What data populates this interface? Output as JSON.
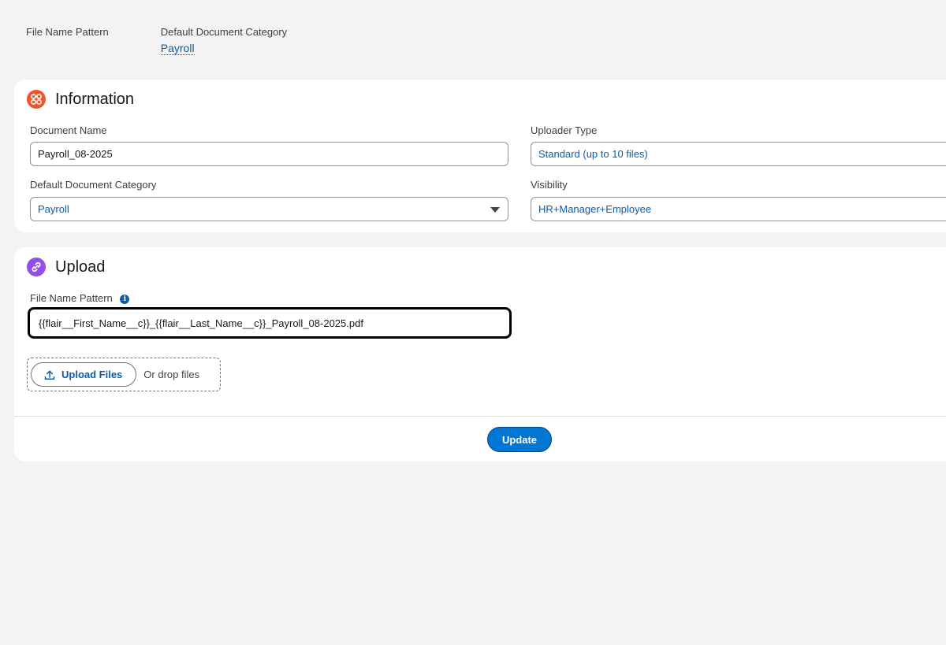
{
  "top_meta": {
    "file_name_pattern_label": "File Name Pattern",
    "default_category_label": "Default Document Category",
    "default_category_value": "Payroll"
  },
  "information": {
    "title": "Information",
    "icon": "apps-icon",
    "document_name_label": "Document Name",
    "document_name_value": "Payroll_08-2025",
    "uploader_type_label": "Uploader Type",
    "uploader_type_value": "Standard (up to 10 files)",
    "default_category_label": "Default Document Category",
    "default_category_value": "Payroll",
    "visibility_label": "Visibility",
    "visibility_value": "HR+Manager+Employee"
  },
  "upload": {
    "title": "Upload",
    "icon": "link-icon",
    "file_name_pattern_label": "File Name Pattern",
    "file_name_pattern_value": "{{flair__First_Name__c}}_{{flair__Last_Name__c}}_Payroll_08-2025.pdf",
    "upload_button_label": "Upload Files",
    "drop_text": "Or drop files",
    "update_button_label": "Update"
  },
  "colors": {
    "accent": "#0176d3",
    "link": "#0b5cab",
    "info_icon_bg": "#f0552b",
    "upload_icon_bg": "#9050e9"
  }
}
